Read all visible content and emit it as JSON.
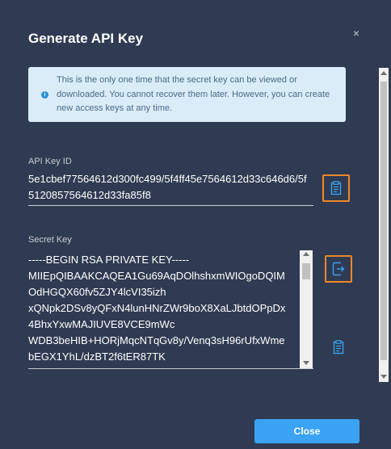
{
  "dialog": {
    "title": "Generate API Key",
    "close_icon": "×"
  },
  "info": {
    "icon": "info-icon",
    "text": "This is the only one time that the secret key can be viewed or downloaded. You cannot recover them later. However, you can create new access keys at any time."
  },
  "api_key": {
    "label": "API Key ID",
    "value": "5e1cbef77564612d300fc499/5f4ff45e7564612d33c646d6/5f5120857564612d33fa85f8"
  },
  "secret_key": {
    "label": "Secret Key",
    "lines": [
      "-----BEGIN RSA PRIVATE KEY-----",
      "MIIEpQIBAAKCAQEA1Gu69AqDOlhshxmWIOgoDQIM",
      "OdHGQX60fv5ZJY4lcVI35izh",
      "xQNpk2DSv8yQFxN4lunHNrZWr9boX8XaLJbtdOPpDx",
      "4BhxYxwMAJIUVE8VCE9mWc",
      "WDB3beHIB+HORjMqcNTqGv8y/Venq3sH96rUfxWme",
      "bEGX1YhL/dzBT2f6tER87TK"
    ]
  },
  "icons": {
    "copy_api_key": "clipboard-icon",
    "download_secret": "export-icon",
    "copy_secret": "clipboard-icon"
  },
  "buttons": {
    "close_label": "Close"
  },
  "colors": {
    "background": "#2f3b52",
    "accent": "#3aa3f5",
    "highlight_border": "#f0872a",
    "info_bg": "#d9ecf8"
  }
}
